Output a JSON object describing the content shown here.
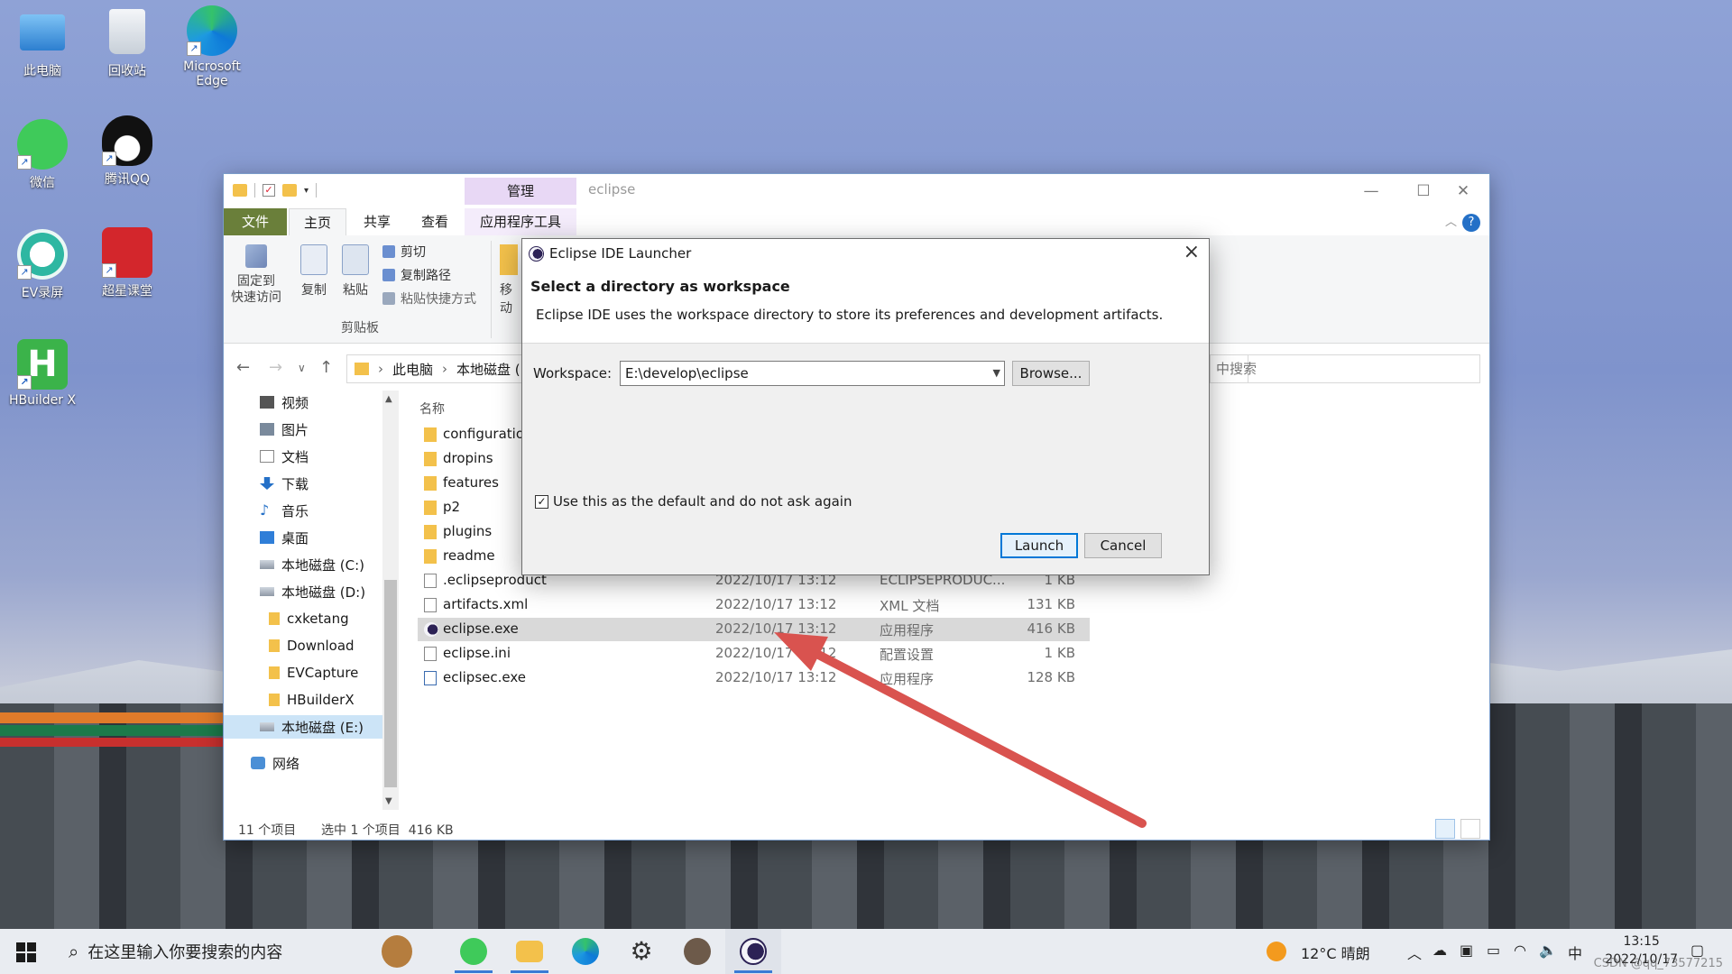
{
  "desktop": {
    "icons": [
      {
        "label": "此电脑"
      },
      {
        "label": "回收站"
      },
      {
        "label": "Microsoft Edge"
      },
      {
        "label": "微信"
      },
      {
        "label": "腾讯QQ"
      },
      {
        "label": "EV录屏"
      },
      {
        "label": "超星课堂"
      },
      {
        "label": "HBuilder X"
      }
    ]
  },
  "explorer": {
    "title": "eclipse",
    "context_tab": "管理",
    "tabs": [
      "文件",
      "主页",
      "共享",
      "查看",
      "应用程序工具"
    ],
    "help": "?",
    "ribbon": {
      "pin_label": "固定到\n快速访问",
      "copy_label": "复制",
      "paste_label": "粘贴",
      "cut_label": "剪切",
      "copy_path_label": "复制路径",
      "paste_shortcut_label": "粘贴快捷方式",
      "move_label": "移动",
      "group_label": "剪贴板"
    },
    "address": {
      "segments": [
        "此电脑",
        "本地磁盘 (E"
      ],
      "search_placeholder": "中搜索"
    },
    "nav": [
      {
        "label": "视频"
      },
      {
        "label": "图片"
      },
      {
        "label": "文档"
      },
      {
        "label": "下载"
      },
      {
        "label": "音乐"
      },
      {
        "label": "桌面"
      },
      {
        "label": "本地磁盘 (C:)"
      },
      {
        "label": "本地磁盘 (D:)"
      },
      {
        "label": "cxketang"
      },
      {
        "label": "Download"
      },
      {
        "label": "EVCapture"
      },
      {
        "label": "HBuilderX"
      },
      {
        "label": "本地磁盘 (E:)"
      },
      {
        "label": "网络"
      }
    ],
    "column_name": "名称",
    "files": [
      {
        "name": "configuratio",
        "date": "",
        "type": "",
        "size": ""
      },
      {
        "name": "dropins",
        "date": "",
        "type": "",
        "size": ""
      },
      {
        "name": "features",
        "date": "",
        "type": "",
        "size": ""
      },
      {
        "name": "p2",
        "date": "",
        "type": "",
        "size": ""
      },
      {
        "name": "plugins",
        "date": "",
        "type": "",
        "size": ""
      },
      {
        "name": "readme",
        "date": "",
        "type": "",
        "size": ""
      },
      {
        "name": ".eclipseproduct",
        "date": "2022/10/17 13:12",
        "type": "ECLIPSEPRODUC...",
        "size": "1 KB"
      },
      {
        "name": "artifacts.xml",
        "date": "2022/10/17 13:12",
        "type": "XML 文档",
        "size": "131 KB"
      },
      {
        "name": "eclipse.exe",
        "date": "2022/10/17 13:12",
        "type": "应用程序",
        "size": "416 KB"
      },
      {
        "name": "eclipse.ini",
        "date": "2022/10/17 13:12",
        "type": "配置设置",
        "size": "1 KB"
      },
      {
        "name": "eclipsec.exe",
        "date": "2022/10/17 13:12",
        "type": "应用程序",
        "size": "128 KB"
      }
    ],
    "status": {
      "count": "11 个项目",
      "selection": "选中 1 个项目  416 KB"
    }
  },
  "dialog": {
    "title": "Eclipse IDE Launcher",
    "heading": "Select a directory as workspace",
    "description": "Eclipse IDE uses the workspace directory to store its preferences and development artifacts.",
    "workspace_label": "Workspace:",
    "workspace_value": "E:\\develop\\eclipse",
    "browse_label": "Browse...",
    "checkbox_label": "Use this as the default and do not ask again",
    "launch_label": "Launch",
    "cancel_label": "Cancel"
  },
  "taskbar": {
    "search_placeholder": "在这里输入你要搜索的内容",
    "weather": "12°C  晴朗",
    "ime": "中",
    "time": "13:15",
    "date": "2022/10/17",
    "watermark": "CSDN @qq_73577215"
  },
  "colors": {
    "accent": "#0078d7",
    "arrow": "#d9534f",
    "selection": "#cce4f7"
  }
}
